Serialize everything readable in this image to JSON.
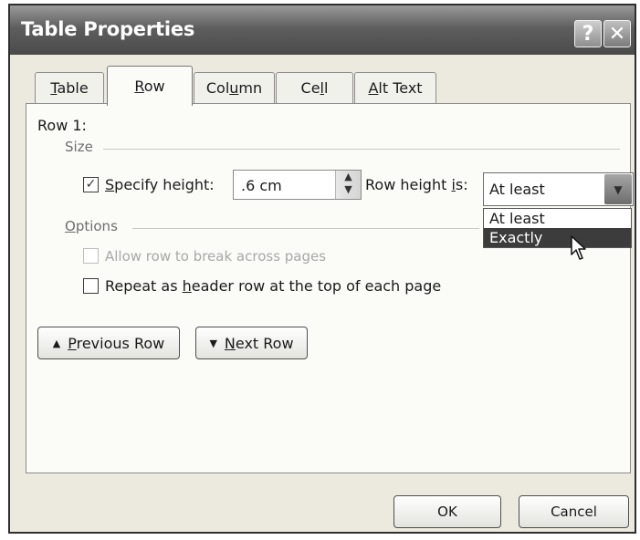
{
  "window": {
    "title": "Table Properties",
    "help_glyph": "?",
    "close_glyph": "✕"
  },
  "tabs": [
    {
      "key": "T",
      "rest": "able",
      "active": false
    },
    {
      "key": "R",
      "rest": "ow",
      "active": true
    },
    {
      "pre": "Col",
      "key": "u",
      "rest": "mn",
      "active": false
    },
    {
      "pre": "Ce",
      "key": "l",
      "rest": "l",
      "active": false
    },
    {
      "key": "A",
      "rest": "lt Text",
      "active": false
    }
  ],
  "row_panel": {
    "row_label": "Row 1:",
    "size_group": "Size",
    "specify_height": {
      "checked": true,
      "key": "S",
      "rest": "pecify height:"
    },
    "height_value": ".6 cm",
    "row_height_is": {
      "pre": "Row height ",
      "key": "i",
      "rest": "s:"
    },
    "row_height_mode": "At least",
    "row_height_options": [
      "At least",
      "Exactly"
    ],
    "highlighted_option": "Exactly",
    "options_group": {
      "key": "O",
      "rest": "ptions"
    },
    "allow_break": {
      "checked": false,
      "enabled": false,
      "text": "Allow row to break across pages"
    },
    "repeat_header": {
      "checked": false,
      "pre": "Repeat as ",
      "key": "h",
      "rest": "eader row at the top of each page"
    },
    "previous_row": {
      "key": "P",
      "rest": "revious Row"
    },
    "next_row": {
      "key": "N",
      "rest": "ext Row"
    }
  },
  "footer": {
    "ok_label": "OK",
    "cancel_label": "Cancel"
  },
  "icons": {
    "checkmark": "check-icon",
    "spin": "spin-arrows-icon",
    "dropdown": "chevron-down-icon",
    "prev": "triangle-up-icon",
    "next": "triangle-down-icon",
    "cursor": "mouse-pointer-icon"
  }
}
